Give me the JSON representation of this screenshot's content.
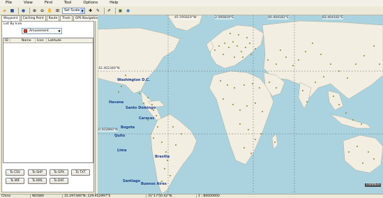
{
  "menubar": {
    "items": [
      "File",
      "View",
      "Find",
      "Tool",
      "Options",
      "Help"
    ]
  },
  "toolbar": {
    "scale_select": "Set Scale"
  },
  "left_panel": {
    "tabs": [
      "Waypoint",
      "Caching Point",
      "Route",
      "Track",
      "GPS Navigation"
    ],
    "list_by_icon_label": "List By Icon",
    "icon_filter_value": "Amusement",
    "columns": [
      "ID",
      "Name",
      "Icon",
      "Latitude"
    ],
    "buttons": [
      "To CSV",
      "To SHP",
      "To GPX",
      "To TXT",
      "To MIF",
      "To KML",
      "To DXF"
    ]
  },
  "map": {
    "city_labels": [
      "Washington D.C.",
      "Havana",
      "Santo Domingo",
      "Caracas",
      "Bogota",
      "Quito",
      "Lima",
      "Brasilia",
      "Santiago",
      "Buenos Aires"
    ],
    "coord_labels": [
      "45.595819°W",
      "2.595819°E",
      "40.404181°E",
      "83.404181°E",
      "42.402340°N",
      "0.502860°N"
    ],
    "scale_badge": "10000km"
  },
  "statusbar": {
    "country": "China",
    "datum": "WGS84",
    "position": "31.297340°N, 129.452997°E",
    "position_dms": "31°17'50.42\"N, 129°27'10.79\"E",
    "scale": "1 : 80000000"
  }
}
